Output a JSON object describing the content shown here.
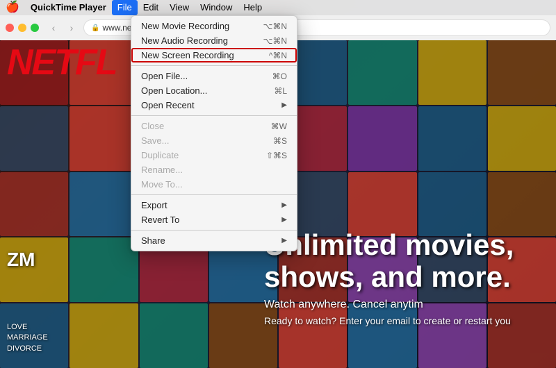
{
  "menubar": {
    "apple": "🍎",
    "items": [
      {
        "label": "QuickTime Player",
        "active": false,
        "bold": true
      },
      {
        "label": "File",
        "active": true
      },
      {
        "label": "Edit",
        "active": false
      },
      {
        "label": "View",
        "active": false
      },
      {
        "label": "Window",
        "active": false
      },
      {
        "label": "Help",
        "active": false
      }
    ]
  },
  "browser": {
    "address": "www.netflix.com/ph/"
  },
  "dropdown": {
    "items": [
      {
        "label": "New Movie Recording",
        "shortcut": "⌥⌘N",
        "disabled": false,
        "highlighted": false,
        "separator": false,
        "hasArrow": false
      },
      {
        "label": "New Audio Recording",
        "shortcut": "⌥⌘N",
        "disabled": false,
        "highlighted": false,
        "separator": false,
        "hasArrow": false
      },
      {
        "label": "New Screen Recording",
        "shortcut": "^⌘N",
        "disabled": false,
        "highlighted": true,
        "separator": true,
        "hasArrow": false
      },
      {
        "label": "Open File...",
        "shortcut": "⌘O",
        "disabled": false,
        "highlighted": false,
        "separator": false,
        "hasArrow": false
      },
      {
        "label": "Open Location...",
        "shortcut": "⌘L",
        "disabled": false,
        "highlighted": false,
        "separator": false,
        "hasArrow": false
      },
      {
        "label": "Open Recent",
        "shortcut": "",
        "disabled": false,
        "highlighted": false,
        "separator": true,
        "hasArrow": true
      },
      {
        "label": "Close",
        "shortcut": "⌘W",
        "disabled": true,
        "highlighted": false,
        "separator": false,
        "hasArrow": false
      },
      {
        "label": "Save...",
        "shortcut": "⌘S",
        "disabled": true,
        "highlighted": false,
        "separator": false,
        "hasArrow": false
      },
      {
        "label": "Duplicate",
        "shortcut": "⇧⌘S",
        "disabled": true,
        "highlighted": false,
        "separator": false,
        "hasArrow": false
      },
      {
        "label": "Rename...",
        "shortcut": "",
        "disabled": true,
        "highlighted": false,
        "separator": false,
        "hasArrow": false
      },
      {
        "label": "Move To...",
        "shortcut": "",
        "disabled": true,
        "highlighted": false,
        "separator": true,
        "hasArrow": false
      },
      {
        "label": "Export",
        "shortcut": "",
        "disabled": false,
        "highlighted": false,
        "separator": false,
        "hasArrow": true
      },
      {
        "label": "Revert To",
        "shortcut": "",
        "disabled": false,
        "highlighted": false,
        "separator": true,
        "hasArrow": true
      },
      {
        "label": "Share",
        "shortcut": "",
        "disabled": false,
        "highlighted": false,
        "separator": false,
        "hasArrow": true
      }
    ]
  },
  "netflix": {
    "logo": "NETFL",
    "hero_line1": "Unlimited movies,",
    "hero_line2": "shows, and more.",
    "watch_text": "Watch anywhere. Cancel anytim",
    "ready_text": "Ready to watch? Enter your email to create or restart you",
    "zm_text": "ZM",
    "bottom_left": "LOVE\nMARRIAGE\nDIVORCE"
  },
  "tiles": {
    "colors": [
      "#8B1A1A",
      "#C0392B",
      "#922B21",
      "#7D3C98",
      "#1A5276",
      "#117864",
      "#B7950B",
      "#784212",
      "#2E4057",
      "#C0392B",
      "#1F618D",
      "#117A65",
      "#9B2335",
      "#6E2F8F",
      "#1A5276",
      "#B7950B",
      "#922B21",
      "#1F618D",
      "#117864",
      "#7D3C98",
      "#2E4057",
      "#C0392B",
      "#1A5276",
      "#784212",
      "#B7950B",
      "#117A65",
      "#9B2335",
      "#1F618D",
      "#922B21",
      "#7D3C98",
      "#2E4057",
      "#C0392B",
      "#1A5276",
      "#B7950B",
      "#117864",
      "#784212",
      "#C0392B",
      "#1F618D",
      "#7D3C98",
      "#922B21"
    ]
  }
}
